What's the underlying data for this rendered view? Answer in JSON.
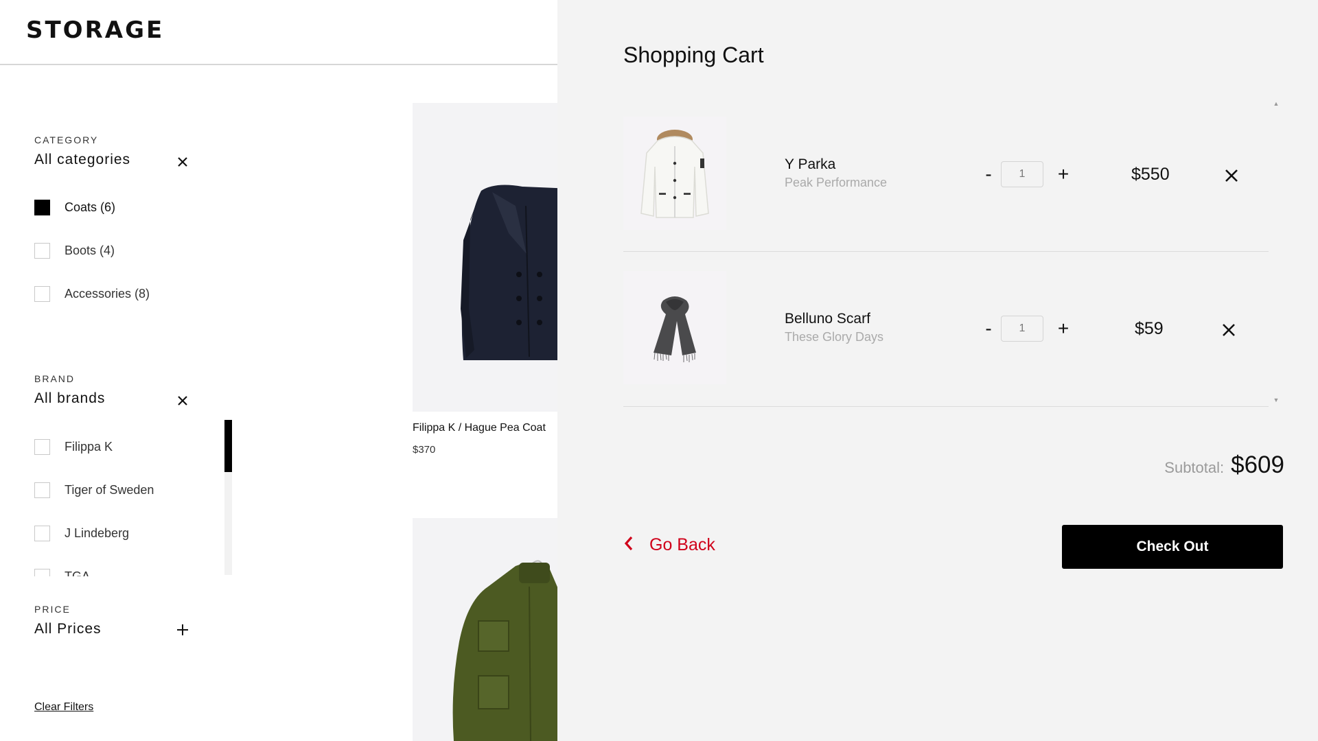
{
  "header": {
    "logo": "STORAGE"
  },
  "filters": {
    "category": {
      "label": "CATEGORY",
      "value": "All categories",
      "options": [
        {
          "label": "Coats (6)",
          "checked": true
        },
        {
          "label": "Boots (4)",
          "checked": false
        },
        {
          "label": "Accessories (8)",
          "checked": false
        }
      ]
    },
    "brand": {
      "label": "BRAND",
      "value": "All brands",
      "options": [
        {
          "label": "Filippa K",
          "checked": false
        },
        {
          "label": "Tiger of Sweden",
          "checked": false
        },
        {
          "label": "J Lindeberg",
          "checked": false
        },
        {
          "label": "TGA",
          "checked": false
        }
      ]
    },
    "price": {
      "label": "PRICE",
      "value": "All Prices"
    },
    "clear_label": "Clear Filters"
  },
  "products": [
    {
      "name": "Filippa K / Hague Pea Coat",
      "price": "$370",
      "icon": "pea-coat-image"
    },
    {
      "name": "",
      "price": "",
      "icon": "field-jacket-image"
    }
  ],
  "cart": {
    "title": "Shopping Cart",
    "items": [
      {
        "name": "Y Parka",
        "brand": "Peak Performance",
        "quantity": "1",
        "price": "$550",
        "icon": "parka-image"
      },
      {
        "name": "Belluno Scarf",
        "brand": "These Glory Days",
        "quantity": "1",
        "price": "$59",
        "icon": "scarf-image"
      }
    ],
    "qty_minus": "-",
    "qty_plus": "+",
    "subtotal_label": "Subtotal:",
    "subtotal_value": "$609",
    "go_back_label": "Go Back",
    "checkout_label": "Check Out"
  },
  "colors": {
    "accent_red": "#d0021b",
    "checkout_bg": "#000000",
    "drawer_bg": "#f3f3f3"
  }
}
